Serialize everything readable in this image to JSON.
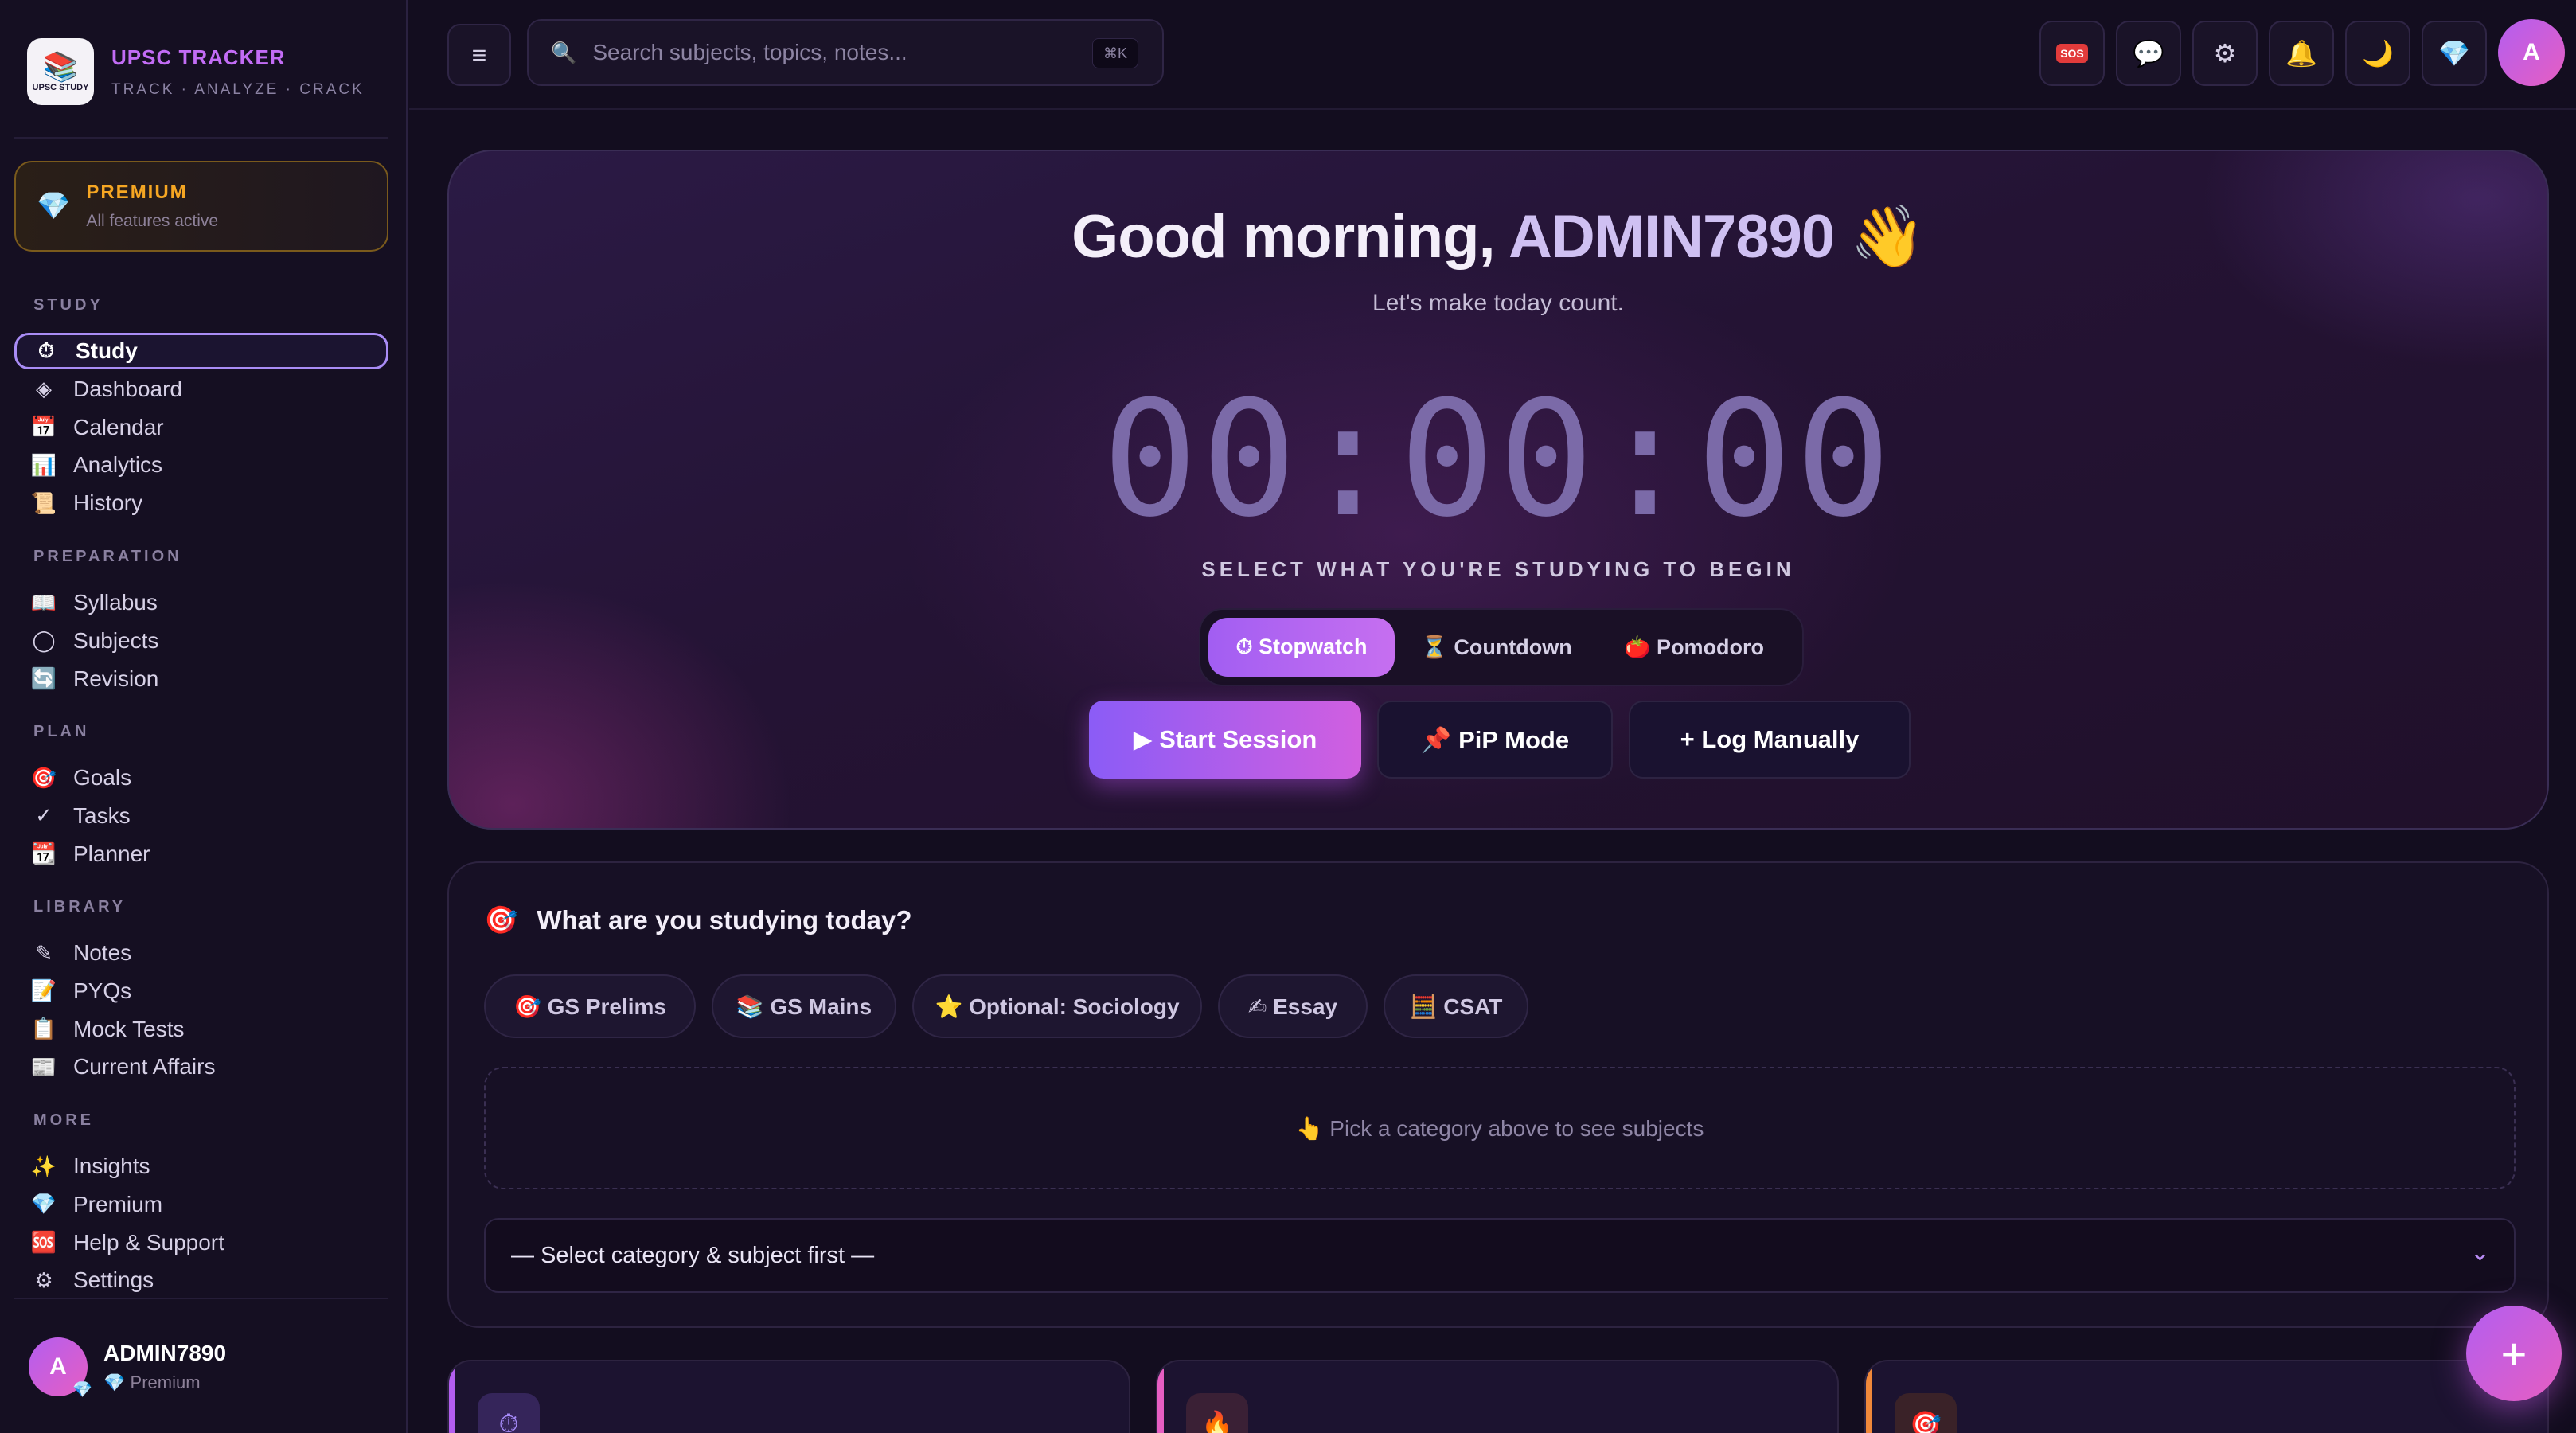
{
  "brand": {
    "title": "UPSC TRACKER",
    "subtitle": "TRACK · ANALYZE · CRACK",
    "logo_text": "UPSC STUDY"
  },
  "premium": {
    "title": "PREMIUM",
    "subtitle": "All features active"
  },
  "sidebar": {
    "sections": [
      {
        "label": "STUDY",
        "items": [
          {
            "icon": "stopwatch-icon",
            "glyph": "⏱",
            "label": "Study",
            "active": true
          },
          {
            "icon": "dashboard-icon",
            "glyph": "◈",
            "label": "Dashboard"
          },
          {
            "icon": "calendar-icon",
            "glyph": "📅",
            "label": "Calendar"
          },
          {
            "icon": "bar-chart-icon",
            "glyph": "📊",
            "label": "Analytics"
          },
          {
            "icon": "scroll-icon",
            "glyph": "📜",
            "label": "History"
          }
        ]
      },
      {
        "label": "PREPARATION",
        "items": [
          {
            "icon": "book-icon",
            "glyph": "📖",
            "label": "Syllabus"
          },
          {
            "icon": "circle-icon",
            "glyph": "◯",
            "label": "Subjects"
          },
          {
            "icon": "refresh-icon",
            "glyph": "🔄",
            "label": "Revision"
          }
        ]
      },
      {
        "label": "PLAN",
        "items": [
          {
            "icon": "target-icon",
            "glyph": "🎯",
            "label": "Goals"
          },
          {
            "icon": "check-icon",
            "glyph": "✓",
            "label": "Tasks"
          },
          {
            "icon": "calendar-day-icon",
            "glyph": "📆",
            "label": "Planner"
          }
        ]
      },
      {
        "label": "LIBRARY",
        "items": [
          {
            "icon": "pencil-icon",
            "glyph": "✎",
            "label": "Notes"
          },
          {
            "icon": "memo-icon",
            "glyph": "📝",
            "label": "PYQs"
          },
          {
            "icon": "clipboard-icon",
            "glyph": "📋",
            "label": "Mock Tests"
          },
          {
            "icon": "newspaper-icon",
            "glyph": "📰",
            "label": "Current Affairs"
          }
        ]
      },
      {
        "label": "MORE",
        "items": [
          {
            "icon": "sparkles-icon",
            "glyph": "✨",
            "label": "Insights"
          },
          {
            "icon": "gem-icon",
            "glyph": "💎",
            "label": "Premium"
          },
          {
            "icon": "sos-icon",
            "glyph": "🆘",
            "label": "Help & Support"
          },
          {
            "icon": "gear-icon",
            "glyph": "⚙",
            "label": "Settings"
          }
        ]
      }
    ]
  },
  "user": {
    "initial": "A",
    "name": "ADMIN7890",
    "plan": "Premium"
  },
  "search": {
    "placeholder": "Search subjects, topics, notes...",
    "shortcut": "⌘K"
  },
  "topbar_icons": [
    {
      "name": "sos-button",
      "glyph": "SOS",
      "sos": true
    },
    {
      "name": "chat-button",
      "glyph": "💬"
    },
    {
      "name": "settings-button",
      "glyph": "⚙"
    },
    {
      "name": "notifications-button",
      "glyph": "🔔"
    },
    {
      "name": "theme-toggle-button",
      "glyph": "🌙"
    },
    {
      "name": "premium-button",
      "glyph": "💎"
    }
  ],
  "hero": {
    "greeting_prefix": "Good morning, ",
    "greeting_name": "ADMIN7890",
    "greeting_emoji": "👋",
    "subline": "Let's make today count.",
    "timer": "00:00:00",
    "select_label": "SELECT WHAT YOU'RE STUDYING TO BEGIN",
    "modes": [
      {
        "label": "⏱ Stopwatch",
        "active": true
      },
      {
        "label": "⏳ Countdown"
      },
      {
        "label": "🍅 Pomodoro"
      }
    ],
    "actions": {
      "start": "▶ Start Session",
      "pip": "📌 PiP Mode",
      "log": "+ Log Manually"
    }
  },
  "study_panel": {
    "title": "What are you studying today?",
    "categories": [
      "🎯 GS Prelims",
      "📚 GS Mains",
      "⭐ Optional: Sociology",
      "✍ Essay",
      "🧮 CSAT"
    ],
    "hint": "👆 Pick a category above to see subjects",
    "select_value": "— Select category & subject first —"
  },
  "colors": {
    "accent": "#a25ef2",
    "premium": "#f5a623",
    "background": "#130d1f"
  }
}
